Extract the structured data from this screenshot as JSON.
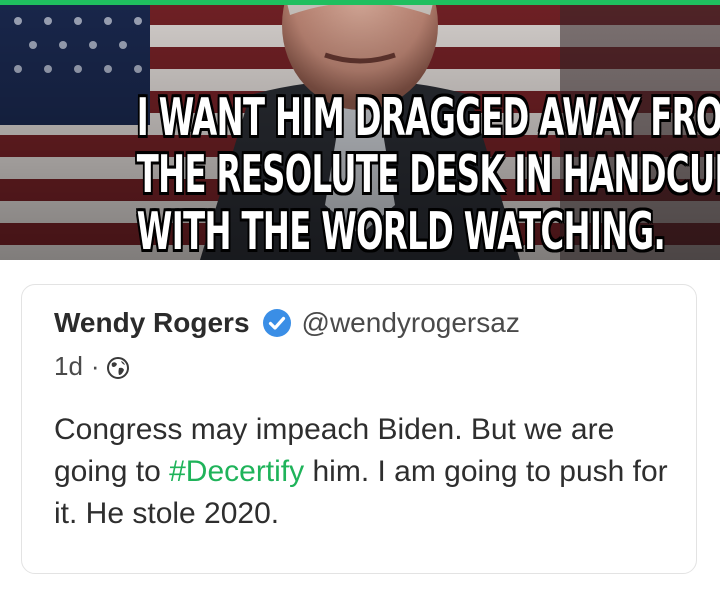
{
  "meme": {
    "caption_lines": [
      "I WANT HIM DRAGGED AWAY FROM",
      "THE RESOLUTE DESK IN HANDCUFFS",
      "WITH THE WORLD WATCHING."
    ]
  },
  "tweet": {
    "author_name": "Wendy Rogers",
    "verified_icon": "verified-badge-icon",
    "handle": "@wendyrogersaz",
    "age": "1d",
    "separator": "·",
    "visibility_icon": "globe-icon",
    "text_before": "Congress may impeach Biden. But we are going to ",
    "hashtag": "#Decertify",
    "text_after": " him. I am going to push for it. He stole 2020."
  },
  "colors": {
    "accent": "#1fbf5f",
    "hashtag": "#1fb35a",
    "verified": "#3a8ee6"
  }
}
